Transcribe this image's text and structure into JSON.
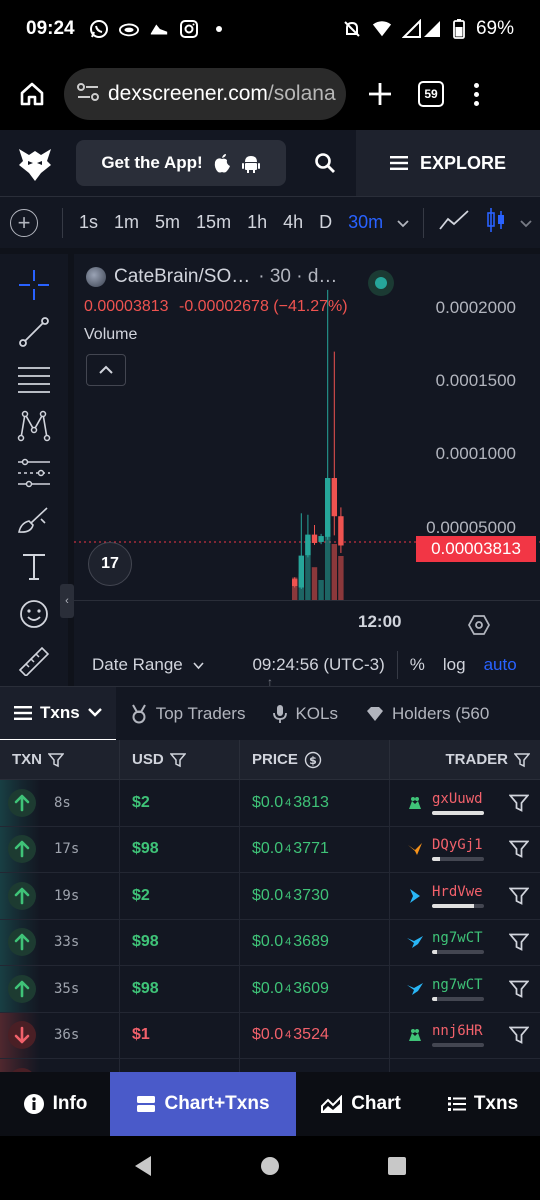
{
  "status_bar": {
    "time": "09:24",
    "battery": "69%",
    "network": "3G"
  },
  "browser": {
    "url_host": "dexscreener.com",
    "url_path": "/solana",
    "tab_count": "59"
  },
  "header": {
    "get_app_label": "Get the App!",
    "explore_label": "EXPLORE"
  },
  "timeframes": {
    "items": [
      "1s",
      "1m",
      "5m",
      "15m",
      "1h",
      "4h",
      "D",
      "30m"
    ],
    "active": "30m"
  },
  "chart": {
    "title": "CateBrain/SO…",
    "interval": "· 30 · d…",
    "price": "0.00003813",
    "change": "-0.00002678",
    "change_pct": "(−41.27%)",
    "volume_label": "Volume",
    "tv_logo": "17",
    "last_price": "0.00003813",
    "x_label": "12:00",
    "date_range_label": "Date Range",
    "time_label": "09:24:56 (UTC-3)",
    "pct_label": "%",
    "log_label": "log",
    "auto_label": "auto"
  },
  "chart_data": {
    "type": "candlestick",
    "y_ticks": [
      "0.0002000",
      "0.0001500",
      "0.0001000",
      "0.00005000"
    ],
    "ylim": [
      1e-06,
      0.000216
    ],
    "last_price": 3.813e-05,
    "x_ticks": [
      "12:00"
    ],
    "candles": [
      {
        "open": 1.52e-05,
        "close": 1.05e-05,
        "high": 1.65e-05,
        "low": 9.5e-06,
        "volume": 0.28
      },
      {
        "open": 9.5e-06,
        "close": 3.12e-05,
        "high": 6e-05,
        "low": 8.5e-06,
        "volume": 0.33
      },
      {
        "open": 3.15e-05,
        "close": 4.55e-05,
        "high": 5.9e-05,
        "low": 3e-05,
        "volume": 0.78
      },
      {
        "open": 4.55e-05,
        "close": 3.98e-05,
        "high": 5.2e-05,
        "low": 3.85e-05,
        "volume": 0.41
      },
      {
        "open": 4.05e-05,
        "close": 4.45e-05,
        "high": 4.6e-05,
        "low": 3.9e-05,
        "volume": 0.25
      },
      {
        "open": 4.4e-05,
        "close": 8.4e-05,
        "high": 0.000212,
        "low": 4.2e-05,
        "volume": 0.95
      },
      {
        "open": 8.4e-05,
        "close": 5.8e-05,
        "high": 0.00017,
        "low": 4.5e-05,
        "volume": 0.7
      },
      {
        "open": 5.8e-05,
        "close": 3.81e-05,
        "high": 6.4e-05,
        "low": 3.3e-05,
        "volume": 0.55
      }
    ]
  },
  "tabs": [
    {
      "label": "Txns",
      "active": true
    },
    {
      "label": "Top Traders",
      "active": false
    },
    {
      "label": "KOLs",
      "active": false
    },
    {
      "label": "Holders (560",
      "active": false
    }
  ],
  "table": {
    "headers": {
      "txn": "TXN",
      "usd": "USD",
      "price": "PRICE",
      "trader": "TRADER"
    },
    "rows": [
      {
        "side": "buy",
        "age": "8s",
        "usd": "$2",
        "price_prefix": "$0.0",
        "price_sub": "4",
        "price_rest": "3813",
        "trader": "gxUuwd",
        "trader_color": "#f2616b",
        "maker": "green",
        "bar": 1.0
      },
      {
        "side": "buy",
        "age": "17s",
        "usd": "$98",
        "price_prefix": "$0.0",
        "price_sub": "4",
        "price_rest": "3771",
        "trader": "DQyGj1",
        "trader_color": "#f2616b",
        "maker": "orange",
        "bar": 0.15
      },
      {
        "side": "buy",
        "age": "19s",
        "usd": "$2",
        "price_prefix": "$0.0",
        "price_sub": "4",
        "price_rest": "3730",
        "trader": "HrdVwe",
        "trader_color": "#f2616b",
        "maker": "blue-arrow",
        "bar": 0.8
      },
      {
        "side": "buy",
        "age": "33s",
        "usd": "$98",
        "price_prefix": "$0.0",
        "price_sub": "4",
        "price_rest": "3689",
        "trader": "ng7wCT",
        "trader_color": "#3fc378",
        "maker": "blue-bird",
        "bar": 0.1
      },
      {
        "side": "buy",
        "age": "35s",
        "usd": "$98",
        "price_prefix": "$0.0",
        "price_sub": "4",
        "price_rest": "3609",
        "trader": "ng7wCT",
        "trader_color": "#3fc378",
        "maker": "blue-bird",
        "bar": 0.1
      },
      {
        "side": "sell",
        "age": "36s",
        "usd": "$1",
        "price_prefix": "$0.0",
        "price_sub": "4",
        "price_rest": "3524",
        "trader": "nnj6HR",
        "trader_color": "#f2616b",
        "maker": "green",
        "bar": 0.0
      },
      {
        "side": "sell",
        "age": "",
        "usd": "",
        "price_prefix": "",
        "price_sub": "",
        "price_rest": "",
        "trader": "",
        "trader_color": "#f2616b",
        "maker": "none",
        "bar": 0.0
      }
    ]
  },
  "bottom_nav": {
    "info": "Info",
    "chart_txns": "Chart+Txns",
    "chart": "Chart",
    "txns": "Txns"
  },
  "colors": {
    "buy": "#3fc378",
    "sell": "#f2616b",
    "accent": "#2962ff",
    "active_nav": "#4a5ac9",
    "panel": "#131722"
  }
}
